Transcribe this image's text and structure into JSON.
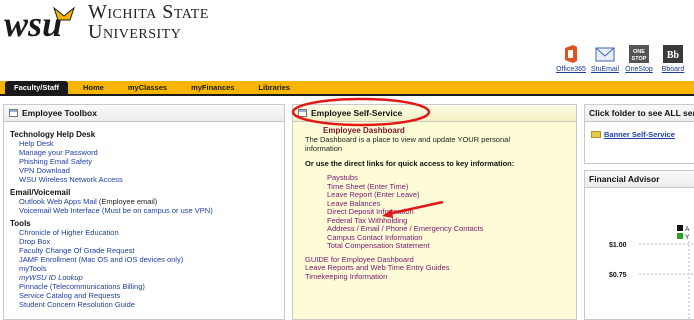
{
  "header": {
    "logo_mark_text": "wsu",
    "university_line1": "Wichita State",
    "university_line2": "University"
  },
  "quick_links": [
    {
      "label": "Office365",
      "icon": "office365-icon"
    },
    {
      "label": "StuEmail",
      "icon": "email-icon"
    },
    {
      "label": "OneStop",
      "icon": "onestop-icon"
    },
    {
      "label": "Bboard",
      "icon": "blackboard-icon"
    }
  ],
  "quick_links_icon_text": {
    "onestop": "ONE STOP",
    "bboard": "Bb"
  },
  "nav": {
    "items": [
      "Faculty/Staff",
      "Home",
      "myClasses",
      "myFinances",
      "Libraries"
    ],
    "active_index": 0
  },
  "left_panel": {
    "title": "Employee Toolbox",
    "sections": [
      {
        "title": "Technology Help Desk",
        "links": [
          "Help Desk",
          "Manage your Password",
          "Phishing Email Safety",
          "VPN Download",
          "WSU Wireless Network Access"
        ]
      },
      {
        "title": "Email/Voicemail",
        "links": [
          "Outlook Web Apps Mail",
          "Voicemail Web Interface (Must be on campus or use VPN)"
        ],
        "link_suffixes": [
          " (Employee email)",
          ""
        ]
      },
      {
        "title": "Tools",
        "links": [
          "Chronicle of Higher Education",
          "Drop Box",
          "Faculty Change Of Grade Request",
          "JAMF Enrollment (Mac OS and iOS devices only)",
          "myTools",
          "myWSU ID Lookup",
          "Pinnacle (Telecommunications Billing)",
          "Service Catalog and Requests",
          "Student Concern Resolution Guide"
        ]
      }
    ]
  },
  "mid_panel": {
    "title": "Employee Self-Service",
    "dashboard_title": "Employee Dashboard",
    "dashboard_desc_line1": "The Dashboard is a place to view and update YOUR personal",
    "dashboard_desc_line2": "information",
    "direct_links_heading": "Or use the direct links for quick access to key information:",
    "links": [
      "Paystubs",
      "Time Sheet (Enter Time)",
      "Leave Report (Enter Leave)",
      "Leave Balances",
      "Direct Deposit Information",
      "Federal Tax Withholding",
      "Address / Email / Phone / Emergency Contacts",
      "Campus Contact Information",
      "Total Compensation Statement"
    ],
    "bottom_links": [
      "GUIDE for Employee Dashboard",
      "Leave Reports and Web Time Entry Guides",
      "Timekeeping Information"
    ]
  },
  "right_panel_1": {
    "title": "Click folder to see ALL serv",
    "link": "Banner Self-Service"
  },
  "right_panel_2": {
    "title": "Financial Advisor",
    "legend": [
      "A",
      "Y"
    ],
    "tick_labels": [
      "$1.00",
      "$0.75"
    ]
  },
  "colors": {
    "gold": "#f7b500",
    "black": "#1a1a1a",
    "link_blue": "#1f3fa8",
    "link_purple": "#7a1570",
    "annotation_red": "#e01818",
    "ess_panel_bg": "#fdfcd7"
  }
}
